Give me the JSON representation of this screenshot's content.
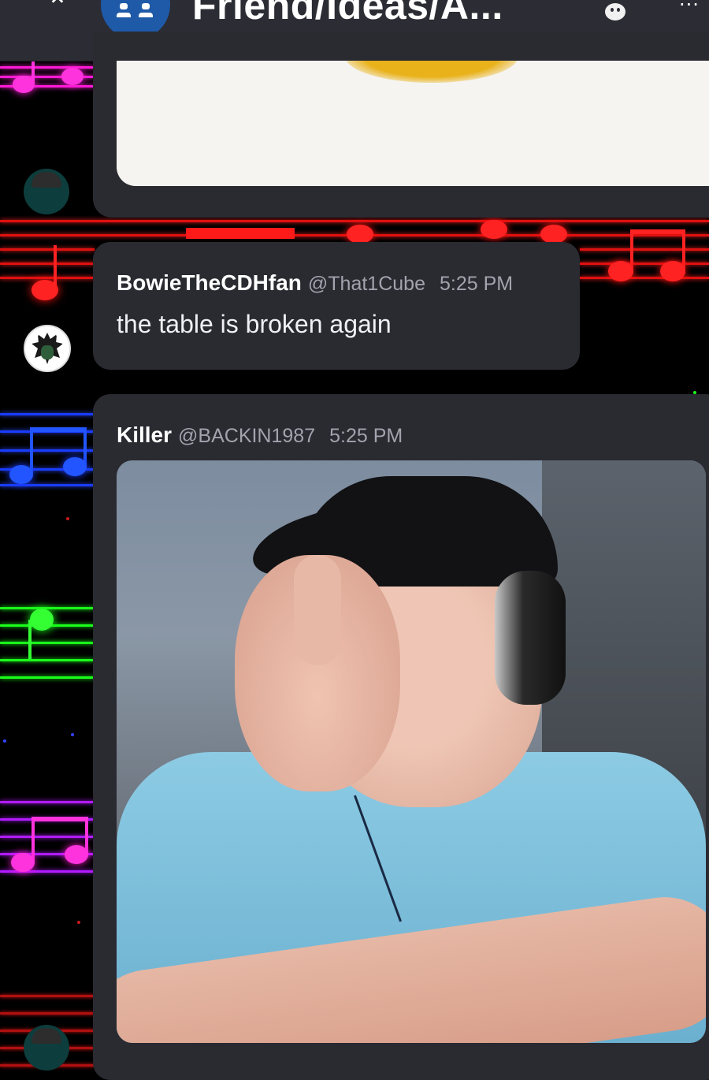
{
  "header": {
    "title": "Friend/Ideas/A...",
    "back_icon": "chevron-up-icon",
    "server_icon": "server-avatar-icon",
    "emoji_icon": "emoji-icon",
    "more_icon": "more-options-icon"
  },
  "messages": [
    {
      "username": "BowieTheCDHfan",
      "handle": "@That1Cube",
      "time": "5:25 PM",
      "text": "the table is broken again"
    },
    {
      "username": "Killer",
      "handle": "@BACKIN1987",
      "time": "5:25 PM",
      "attachment": "video"
    }
  ],
  "colors": {
    "header_bg": "#2c2c34",
    "card_bg": "#2a2a31",
    "muted_text": "#a3a3ae",
    "staff_red": "#e01010",
    "staff_blue": "#1a3cff",
    "staff_green": "#1bff1b",
    "staff_purple": "#b21bff",
    "staff_magenta": "#ff1bd6"
  }
}
